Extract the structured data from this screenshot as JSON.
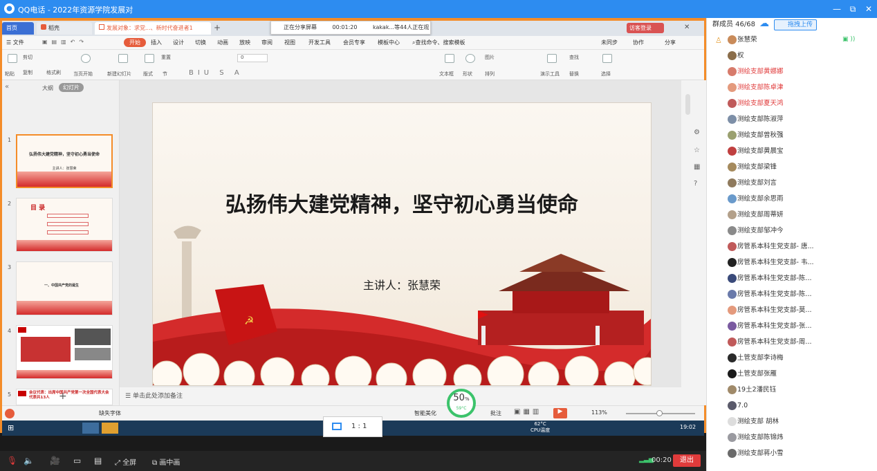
{
  "window": {
    "title": "QQ电话 - 2022年资源学院发展对",
    "controls": [
      "—",
      "⧉",
      "✕"
    ]
  },
  "wps_tabs": [
    {
      "label": "首页"
    },
    {
      "label": "稻壳"
    },
    {
      "label": "发展对象：求党...、新时代奋进者1"
    }
  ],
  "share_status": {
    "sharing": "正在分享屏幕",
    "time": "00:01:20",
    "viewers": "kakak...等44人正在观看"
  },
  "login_label": "访客登录",
  "menu": {
    "file": "文件",
    "items": [
      "开始",
      "插入",
      "设计",
      "切换",
      "动画",
      "放映",
      "审阅",
      "视图",
      "开发工具",
      "会员专享",
      "模板中心"
    ],
    "search": "查找命令、搜索模板",
    "right": [
      "未同步",
      "协作",
      "分享"
    ]
  },
  "ribbon": {
    "labels": [
      "粘贴",
      "剪切",
      "复制",
      "格式刷",
      "当页开始",
      "新建幻灯片",
      "版式",
      "节",
      "重置",
      "文本框",
      "形状",
      "图片",
      "排列",
      "演示工具",
      "查找",
      "替换",
      "选择"
    ],
    "font_size": "0"
  },
  "panel_tabs": [
    "大纲",
    "幻灯片"
  ],
  "thumbs": [
    {
      "num": "1",
      "title": "弘扬伟大建党精神，坚守初心勇当使命",
      "sub": "主讲人：张慧荣"
    },
    {
      "num": "2",
      "title": "目 录",
      "sub": ""
    },
    {
      "num": "3",
      "title": "一、中国共产党的诞生",
      "sub": ""
    },
    {
      "num": "4",
      "title": "",
      "sub": ""
    },
    {
      "num": "5",
      "title": "会议代表：出席中国共产党第一次全国代表大会代表共13人",
      "sub": ""
    }
  ],
  "slide": {
    "title": "弘扬伟大建党精神，坚守初心勇当使命",
    "speaker": "主讲人：张慧荣"
  },
  "notes_placeholder": "单击此处添加备注",
  "status": {
    "font_missing": "缺失字体",
    "smart": "智能美化",
    "annotation": "批注",
    "zoom": "113%",
    "cpu_percent": "50",
    "cpu_percent_unit": "%",
    "cpu_temp": "59°C",
    "temp_label": "62°C",
    "cpu_label": "CPU温度",
    "time": "19:02"
  },
  "zoom_popup": "1 : 1",
  "bottom": {
    "fullscreen": "全屏",
    "pip": "画中画",
    "call_time": "00:20",
    "exit": "退出"
  },
  "members_panel": {
    "header": "群成员 46/68",
    "upload": "拖拽上传"
  },
  "members": [
    {
      "name": "张慧荣",
      "red": false,
      "color": "#c98b5a"
    },
    {
      "name": "权",
      "red": false,
      "color": "#8a6d4a"
    },
    {
      "name": "测绘支部黄娜娜",
      "red": true,
      "color": "#d77b6b"
    },
    {
      "name": "测绘支部陈卓津",
      "red": true,
      "color": "#e49a7d"
    },
    {
      "name": "测绘支部夏天鸿",
      "red": true,
      "color": "#c05a5a"
    },
    {
      "name": "测绘支部陈淑萍",
      "red": false,
      "color": "#7d8fa7"
    },
    {
      "name": "测绘支部曾秋强",
      "red": false,
      "color": "#9aa070"
    },
    {
      "name": "测绘支部黄晨宝",
      "red": false,
      "color": "#c04040"
    },
    {
      "name": "测绘支部梁锋",
      "red": false,
      "color": "#a58a5d"
    },
    {
      "name": "测绘支部刘言",
      "red": false,
      "color": "#8f7a5d"
    },
    {
      "name": "测绘支部余思雨",
      "red": false,
      "color": "#6a9acb"
    },
    {
      "name": "测绘支部周蒂妍",
      "red": false,
      "color": "#b3a08a"
    },
    {
      "name": "测绘支部邹冲今",
      "red": false,
      "color": "#8a8a8a"
    },
    {
      "name": "房管系本科生党支部- 唐...",
      "red": false,
      "color": "#c05a5a"
    },
    {
      "name": "房管系本科生党支部- 韦...",
      "red": false,
      "color": "#222222"
    },
    {
      "name": "房管系本科生党支部-陈...",
      "red": false,
      "color": "#3a4a7a"
    },
    {
      "name": "房管系本科生党支部-陈...",
      "red": false,
      "color": "#6a7aaa"
    },
    {
      "name": "房管系本科生党支部-莫...",
      "red": false,
      "color": "#e49a7d"
    },
    {
      "name": "房管系本科生党支部-张...",
      "red": false,
      "color": "#7a5aa0"
    },
    {
      "name": "房管系本科生党支部-周...",
      "red": false,
      "color": "#c05a5a"
    },
    {
      "name": "土管支部李诗梅",
      "red": false,
      "color": "#2a2a2a"
    },
    {
      "name": "土管支部张雁",
      "red": false,
      "color": "#1a1a1a"
    },
    {
      "name": "19土2潘民钰",
      "red": false,
      "color": "#a08a6a"
    },
    {
      "name": "7.0",
      "red": false,
      "color": "#5a5a6a"
    },
    {
      "name": "测绘支部 胡林",
      "red": false,
      "color": "#dddddd"
    },
    {
      "name": "测绘支部陈锦炜",
      "red": false,
      "color": "#9a9aa0"
    },
    {
      "name": "测绘支部蒋小雪",
      "red": false,
      "color": "#6a6a6a"
    }
  ]
}
